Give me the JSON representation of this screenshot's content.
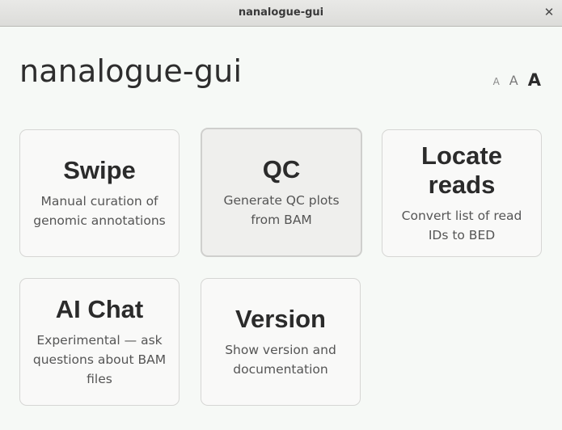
{
  "window": {
    "title": "nanalogue-gui",
    "close_glyph": "✕"
  },
  "header": {
    "app_title": "nanalogue-gui",
    "font_sizes": [
      "A",
      "A",
      "A"
    ]
  },
  "cards": [
    {
      "title": "Swipe",
      "description": "Manual curation of genomic annotations"
    },
    {
      "title": "QC",
      "description": "Generate QC plots from BAM"
    },
    {
      "title": "Locate reads",
      "description": "Convert list of read IDs to BED"
    },
    {
      "title": "AI Chat",
      "description": "Experimental — ask questions about BAM files"
    },
    {
      "title": "Version",
      "description": "Show version and documentation"
    }
  ]
}
